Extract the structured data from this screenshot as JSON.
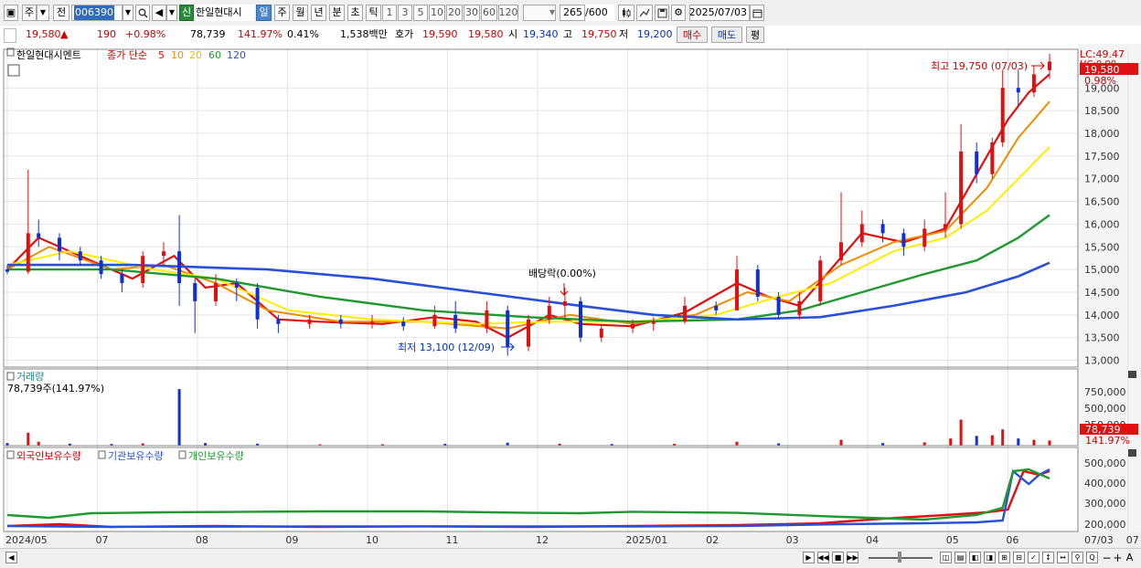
{
  "toolbar": {
    "market": "주",
    "scope": "전",
    "code": "006390",
    "new_badge": "신",
    "name": "한일현대시",
    "periods": [
      "일",
      "주",
      "월",
      "년",
      "분",
      "초",
      "틱"
    ],
    "active_period": "일",
    "intervals": [
      "1",
      "3",
      "5",
      "10",
      "20",
      "30",
      "60",
      "120"
    ],
    "count": "265",
    "count_max": "/600",
    "date": "2025/07/03"
  },
  "info": {
    "price": "19,580",
    "change_arrow": "▲",
    "change": "190",
    "change_pct": "+0.98%",
    "volume": "78,739",
    "volume_ratio": "141.97%",
    "turnover": "0.41%",
    "amount": "1,538백만",
    "ask_label": "호가",
    "ask1": "19,590",
    "ask2": "19,580",
    "open_label": "시",
    "open": "19,340",
    "high_label": "고",
    "high": "19,750",
    "low_label": "저",
    "low": "19,200",
    "buy": "매수",
    "sell": "매도",
    "eval": "평"
  },
  "price_panel": {
    "name": "한일현대시멘트",
    "ma_label": "종가 단순",
    "ma_periods": [
      "5",
      "10",
      "20",
      "60",
      "120"
    ],
    "ma_colors": [
      "#e01010",
      "#f08c00",
      "#ffee00",
      "#209a30",
      "#2850d8"
    ],
    "lc": "LC:49.47",
    "lc_sub": "HC:0.00",
    "price_tag": "19,580",
    "pct_tag": "0.98%",
    "high_note": "최고 19,750 (07/03)",
    "low_note": "최저 13,100 (12/09)",
    "dividend_note": "배당락(0.00%)"
  },
  "volume_panel": {
    "title": "거래량",
    "value": "78,739주(141.97%)",
    "tag": "78,739",
    "pct": "141.97%",
    "ticks": [
      "750,000",
      "500,000",
      "250,000"
    ]
  },
  "holding_panel": {
    "series": [
      "외국인보유수량",
      "기관보유수량",
      "개인보유수량"
    ],
    "ticks": [
      "500,000",
      "400,000",
      "300,000",
      "200,000"
    ]
  },
  "x_labels": [
    "2024/05",
    "07",
    "08",
    "09",
    "10",
    "11",
    "12",
    "2025/01",
    "02",
    "03",
    "04",
    "05",
    "06",
    "07",
    "07/03"
  ],
  "chart_data": {
    "type": "candlestick",
    "price_axis_ticks": [
      13000,
      13500,
      14000,
      14500,
      15000,
      15500,
      16000,
      16500,
      17000,
      17500,
      18000,
      18500,
      19000
    ],
    "price_range": [
      12850,
      19850
    ],
    "candles": [
      {
        "t": 0.0,
        "o": 15000,
        "h": 15100,
        "l": 14900,
        "c": 14950
      },
      {
        "t": 0.02,
        "o": 14950,
        "h": 17200,
        "l": 14900,
        "c": 15800
      },
      {
        "t": 0.03,
        "o": 15800,
        "h": 16100,
        "l": 15500,
        "c": 15700
      },
      {
        "t": 0.05,
        "o": 15700,
        "h": 15800,
        "l": 15200,
        "c": 15400
      },
      {
        "t": 0.07,
        "o": 15400,
        "h": 15500,
        "l": 15100,
        "c": 15200
      },
      {
        "t": 0.09,
        "o": 15200,
        "h": 15300,
        "l": 14800,
        "c": 14900
      },
      {
        "t": 0.11,
        "o": 14900,
        "h": 15000,
        "l": 14500,
        "c": 14700
      },
      {
        "t": 0.13,
        "o": 14700,
        "h": 15400,
        "l": 14600,
        "c": 15300
      },
      {
        "t": 0.15,
        "o": 15300,
        "h": 15600,
        "l": 15100,
        "c": 15400
      },
      {
        "t": 0.165,
        "o": 15400,
        "h": 16200,
        "l": 14200,
        "c": 14700
      },
      {
        "t": 0.18,
        "o": 14700,
        "h": 14800,
        "l": 13600,
        "c": 14300
      },
      {
        "t": 0.2,
        "o": 14300,
        "h": 14900,
        "l": 14200,
        "c": 14700
      },
      {
        "t": 0.22,
        "o": 14700,
        "h": 14800,
        "l": 14300,
        "c": 14600
      },
      {
        "t": 0.24,
        "o": 14600,
        "h": 14700,
        "l": 13700,
        "c": 13900
      },
      {
        "t": 0.26,
        "o": 13900,
        "h": 14000,
        "l": 13600,
        "c": 13800
      },
      {
        "t": 0.29,
        "o": 13800,
        "h": 14000,
        "l": 13700,
        "c": 13900
      },
      {
        "t": 0.32,
        "o": 13900,
        "h": 14000,
        "l": 13700,
        "c": 13800
      },
      {
        "t": 0.35,
        "o": 13800,
        "h": 14000,
        "l": 13700,
        "c": 13850
      },
      {
        "t": 0.38,
        "o": 13850,
        "h": 13950,
        "l": 13650,
        "c": 13750
      },
      {
        "t": 0.41,
        "o": 13750,
        "h": 14200,
        "l": 13700,
        "c": 14000
      },
      {
        "t": 0.43,
        "o": 14000,
        "h": 14300,
        "l": 13600,
        "c": 13700
      },
      {
        "t": 0.46,
        "o": 13700,
        "h": 14300,
        "l": 13600,
        "c": 14100
      },
      {
        "t": 0.48,
        "o": 14100,
        "h": 14200,
        "l": 13100,
        "c": 13300
      },
      {
        "t": 0.5,
        "o": 13300,
        "h": 14000,
        "l": 13200,
        "c": 13900
      },
      {
        "t": 0.52,
        "o": 13900,
        "h": 14400,
        "l": 13800,
        "c": 14200
      },
      {
        "t": 0.535,
        "o": 14200,
        "h": 14600,
        "l": 13900,
        "c": 14300
      },
      {
        "t": 0.55,
        "o": 14300,
        "h": 14400,
        "l": 13400,
        "c": 13500
      },
      {
        "t": 0.57,
        "o": 13500,
        "h": 13800,
        "l": 13400,
        "c": 13700
      },
      {
        "t": 0.6,
        "o": 13700,
        "h": 13900,
        "l": 13600,
        "c": 13800
      },
      {
        "t": 0.62,
        "o": 13800,
        "h": 13950,
        "l": 13650,
        "c": 13850
      },
      {
        "t": 0.65,
        "o": 13850,
        "h": 14400,
        "l": 13800,
        "c": 14200
      },
      {
        "t": 0.68,
        "o": 14200,
        "h": 14300,
        "l": 14000,
        "c": 14100
      },
      {
        "t": 0.7,
        "o": 14100,
        "h": 15300,
        "l": 14100,
        "c": 15000
      },
      {
        "t": 0.72,
        "o": 15000,
        "h": 15100,
        "l": 14300,
        "c": 14400
      },
      {
        "t": 0.74,
        "o": 14400,
        "h": 14500,
        "l": 13900,
        "c": 14000
      },
      {
        "t": 0.76,
        "o": 14000,
        "h": 14500,
        "l": 13900,
        "c": 14300
      },
      {
        "t": 0.78,
        "o": 14300,
        "h": 15300,
        "l": 14200,
        "c": 15200
      },
      {
        "t": 0.8,
        "o": 15200,
        "h": 16700,
        "l": 15100,
        "c": 15600
      },
      {
        "t": 0.82,
        "o": 15600,
        "h": 16300,
        "l": 15500,
        "c": 16000
      },
      {
        "t": 0.84,
        "o": 16000,
        "h": 16100,
        "l": 15600,
        "c": 15800
      },
      {
        "t": 0.86,
        "o": 15800,
        "h": 15900,
        "l": 15300,
        "c": 15500
      },
      {
        "t": 0.88,
        "o": 15500,
        "h": 16100,
        "l": 15400,
        "c": 15900
      },
      {
        "t": 0.9,
        "o": 15900,
        "h": 16700,
        "l": 15700,
        "c": 16000
      },
      {
        "t": 0.915,
        "o": 16000,
        "h": 18200,
        "l": 15900,
        "c": 17600
      },
      {
        "t": 0.93,
        "o": 17600,
        "h": 17800,
        "l": 16900,
        "c": 17100
      },
      {
        "t": 0.945,
        "o": 17100,
        "h": 17900,
        "l": 17000,
        "c": 17800
      },
      {
        "t": 0.955,
        "o": 17800,
        "h": 19400,
        "l": 17700,
        "c": 19000
      },
      {
        "t": 0.97,
        "o": 19000,
        "h": 19400,
        "l": 18600,
        "c": 18900
      },
      {
        "t": 0.985,
        "o": 18900,
        "h": 19500,
        "l": 18800,
        "c": 19300
      },
      {
        "t": 1.0,
        "o": 19390,
        "h": 19750,
        "l": 19200,
        "c": 19580
      }
    ],
    "ma": [
      {
        "period": 5,
        "points": [
          [
            0.0,
            15000
          ],
          [
            0.03,
            15700
          ],
          [
            0.08,
            15200
          ],
          [
            0.12,
            14800
          ],
          [
            0.16,
            15300
          ],
          [
            0.19,
            14600
          ],
          [
            0.22,
            14700
          ],
          [
            0.26,
            13900
          ],
          [
            0.3,
            13850
          ],
          [
            0.36,
            13800
          ],
          [
            0.41,
            13950
          ],
          [
            0.45,
            13850
          ],
          [
            0.48,
            13500
          ],
          [
            0.52,
            14000
          ],
          [
            0.55,
            13800
          ],
          [
            0.6,
            13750
          ],
          [
            0.65,
            14050
          ],
          [
            0.7,
            14700
          ],
          [
            0.73,
            14400
          ],
          [
            0.76,
            14200
          ],
          [
            0.79,
            15000
          ],
          [
            0.82,
            15800
          ],
          [
            0.86,
            15600
          ],
          [
            0.9,
            15900
          ],
          [
            0.93,
            17100
          ],
          [
            0.96,
            18300
          ],
          [
            0.98,
            18900
          ],
          [
            1.0,
            19300
          ]
        ]
      },
      {
        "period": 10,
        "points": [
          [
            0.0,
            15000
          ],
          [
            0.04,
            15500
          ],
          [
            0.1,
            15000
          ],
          [
            0.15,
            15100
          ],
          [
            0.2,
            14700
          ],
          [
            0.25,
            14100
          ],
          [
            0.32,
            13850
          ],
          [
            0.4,
            13850
          ],
          [
            0.48,
            13700
          ],
          [
            0.54,
            14000
          ],
          [
            0.6,
            13800
          ],
          [
            0.66,
            14000
          ],
          [
            0.71,
            14500
          ],
          [
            0.75,
            14300
          ],
          [
            0.8,
            15100
          ],
          [
            0.85,
            15600
          ],
          [
            0.9,
            15850
          ],
          [
            0.94,
            16800
          ],
          [
            0.97,
            17900
          ],
          [
            1.0,
            18700
          ]
        ]
      },
      {
        "period": 20,
        "points": [
          [
            0.0,
            15100
          ],
          [
            0.06,
            15400
          ],
          [
            0.14,
            15000
          ],
          [
            0.2,
            14800
          ],
          [
            0.27,
            14100
          ],
          [
            0.35,
            13900
          ],
          [
            0.45,
            13800
          ],
          [
            0.52,
            13850
          ],
          [
            0.6,
            13850
          ],
          [
            0.68,
            14000
          ],
          [
            0.74,
            14400
          ],
          [
            0.79,
            14700
          ],
          [
            0.85,
            15400
          ],
          [
            0.9,
            15700
          ],
          [
            0.94,
            16300
          ],
          [
            0.97,
            17000
          ],
          [
            1.0,
            17700
          ]
        ]
      },
      {
        "period": 60,
        "points": [
          [
            0.0,
            15000
          ],
          [
            0.1,
            15000
          ],
          [
            0.2,
            14800
          ],
          [
            0.3,
            14400
          ],
          [
            0.4,
            14100
          ],
          [
            0.5,
            13950
          ],
          [
            0.6,
            13850
          ],
          [
            0.7,
            13900
          ],
          [
            0.76,
            14100
          ],
          [
            0.82,
            14500
          ],
          [
            0.88,
            14900
          ],
          [
            0.93,
            15200
          ],
          [
            0.97,
            15700
          ],
          [
            1.0,
            16200
          ]
        ]
      },
      {
        "period": 120,
        "points": [
          [
            0.0,
            15100
          ],
          [
            0.12,
            15100
          ],
          [
            0.25,
            15000
          ],
          [
            0.35,
            14800
          ],
          [
            0.45,
            14500
          ],
          [
            0.55,
            14200
          ],
          [
            0.62,
            14000
          ],
          [
            0.7,
            13900
          ],
          [
            0.78,
            13950
          ],
          [
            0.85,
            14200
          ],
          [
            0.92,
            14500
          ],
          [
            0.97,
            14850
          ],
          [
            1.0,
            15150
          ]
        ]
      }
    ],
    "volume_axis_max": 900000,
    "volumes": [
      {
        "t": 0.0,
        "v": 40000,
        "up": false
      },
      {
        "t": 0.02,
        "v": 200000,
        "up": true
      },
      {
        "t": 0.03,
        "v": 60000,
        "up": true
      },
      {
        "t": 0.06,
        "v": 30000,
        "up": false
      },
      {
        "t": 0.1,
        "v": 25000,
        "up": false
      },
      {
        "t": 0.13,
        "v": 35000,
        "up": true
      },
      {
        "t": 0.165,
        "v": 870000,
        "up": false
      },
      {
        "t": 0.19,
        "v": 40000,
        "up": false
      },
      {
        "t": 0.24,
        "v": 30000,
        "up": false
      },
      {
        "t": 0.3,
        "v": 20000,
        "up": true
      },
      {
        "t": 0.36,
        "v": 22000,
        "up": true
      },
      {
        "t": 0.42,
        "v": 28000,
        "up": false
      },
      {
        "t": 0.48,
        "v": 45000,
        "up": false
      },
      {
        "t": 0.53,
        "v": 30000,
        "up": true
      },
      {
        "t": 0.58,
        "v": 25000,
        "up": false
      },
      {
        "t": 0.64,
        "v": 28000,
        "up": true
      },
      {
        "t": 0.7,
        "v": 60000,
        "up": true
      },
      {
        "t": 0.74,
        "v": 35000,
        "up": false
      },
      {
        "t": 0.8,
        "v": 90000,
        "up": true
      },
      {
        "t": 0.84,
        "v": 40000,
        "up": false
      },
      {
        "t": 0.88,
        "v": 50000,
        "up": true
      },
      {
        "t": 0.905,
        "v": 110000,
        "up": true
      },
      {
        "t": 0.915,
        "v": 400000,
        "up": true
      },
      {
        "t": 0.93,
        "v": 150000,
        "up": false
      },
      {
        "t": 0.945,
        "v": 160000,
        "up": true
      },
      {
        "t": 0.955,
        "v": 250000,
        "up": true
      },
      {
        "t": 0.97,
        "v": 110000,
        "up": false
      },
      {
        "t": 0.985,
        "v": 90000,
        "up": true
      },
      {
        "t": 1.0,
        "v": 78739,
        "up": true
      }
    ],
    "holding_axis_range": [
      180000,
      540000
    ],
    "holdings": [
      {
        "name": "외국인보유수량",
        "color": "#e01010",
        "points": [
          [
            0.0,
            200000
          ],
          [
            0.05,
            210000
          ],
          [
            0.1,
            195000
          ],
          [
            0.2,
            200000
          ],
          [
            0.3,
            195000
          ],
          [
            0.4,
            198000
          ],
          [
            0.5,
            195000
          ],
          [
            0.6,
            200000
          ],
          [
            0.7,
            205000
          ],
          [
            0.78,
            215000
          ],
          [
            0.84,
            240000
          ],
          [
            0.9,
            260000
          ],
          [
            0.94,
            275000
          ],
          [
            0.96,
            290000
          ],
          [
            0.975,
            500000
          ],
          [
            0.99,
            480000
          ],
          [
            1.0,
            500000
          ]
        ]
      },
      {
        "name": "기관보유수량",
        "color": "#2850d8",
        "points": [
          [
            0.0,
            200000
          ],
          [
            0.1,
            195000
          ],
          [
            0.3,
            198000
          ],
          [
            0.5,
            198000
          ],
          [
            0.6,
            197000
          ],
          [
            0.7,
            200000
          ],
          [
            0.8,
            210000
          ],
          [
            0.88,
            215000
          ],
          [
            0.93,
            220000
          ],
          [
            0.955,
            230000
          ],
          [
            0.965,
            500000
          ],
          [
            0.98,
            430000
          ],
          [
            0.99,
            480000
          ],
          [
            1.0,
            510000
          ]
        ]
      },
      {
        "name": "개인보유수량",
        "color": "#209a30",
        "points": [
          [
            0.0,
            260000
          ],
          [
            0.04,
            245000
          ],
          [
            0.08,
            270000
          ],
          [
            0.15,
            275000
          ],
          [
            0.3,
            280000
          ],
          [
            0.4,
            280000
          ],
          [
            0.5,
            272000
          ],
          [
            0.55,
            270000
          ],
          [
            0.6,
            278000
          ],
          [
            0.7,
            272000
          ],
          [
            0.8,
            250000
          ],
          [
            0.88,
            235000
          ],
          [
            0.93,
            260000
          ],
          [
            0.955,
            300000
          ],
          [
            0.965,
            500000
          ],
          [
            0.98,
            510000
          ],
          [
            1.0,
            460000
          ]
        ]
      }
    ]
  }
}
